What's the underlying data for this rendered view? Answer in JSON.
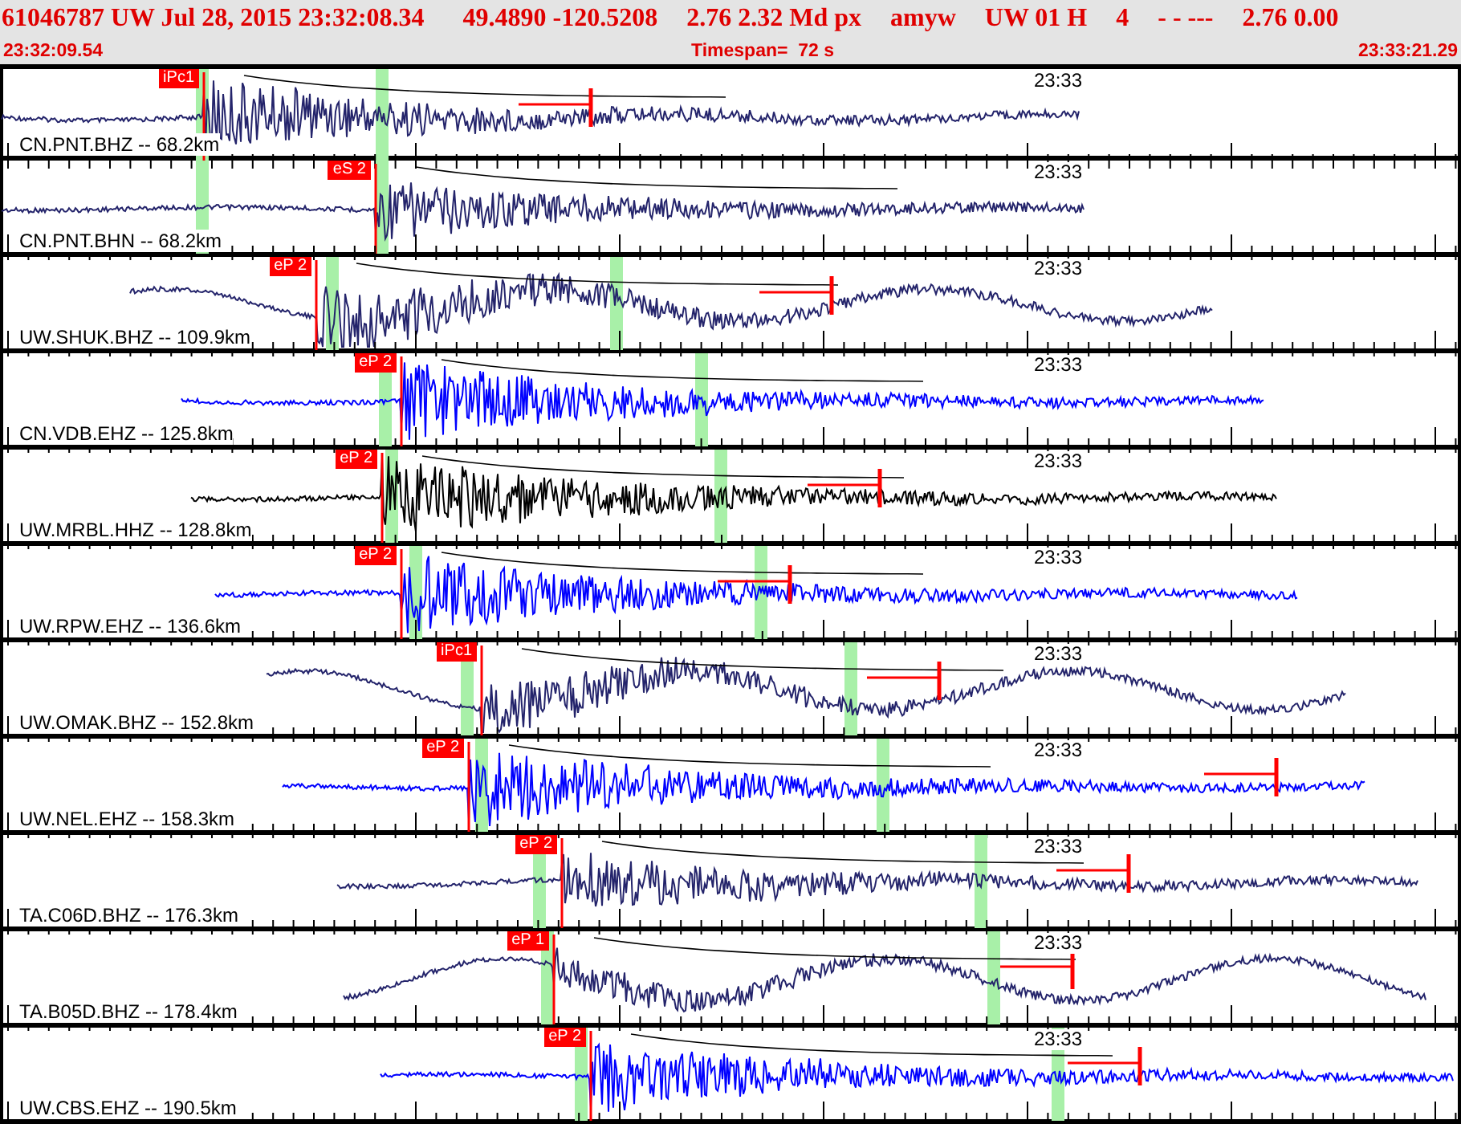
{
  "header": {
    "fields": [
      "61046787 UW Jul 28, 2015 23:32:08.34",
      "49.4890 -120.5208",
      "2.76 2.32 Md px",
      "amyw",
      "UW 01 H",
      "4",
      "- - ---",
      "2.76 0.00"
    ],
    "start_time": "23:32:09.54",
    "timespan": "Timespan=  72 s",
    "end_time": "23:33:21.29"
  },
  "traces": [
    {
      "channel": "CN.PNT.BHZ -- 68.2km",
      "pick": "iPc1",
      "time_mark": "23:33",
      "color": "#24246b"
    },
    {
      "channel": "CN.PNT.BHN -- 68.2km",
      "pick": "eS 2",
      "time_mark": "23:33",
      "color": "#24246b"
    },
    {
      "channel": "UW.SHUK.BHZ -- 109.9km",
      "pick": "eP 2",
      "time_mark": "23:33",
      "color": "#24246b"
    },
    {
      "channel": "CN.VDB.EHZ -- 125.8km",
      "pick": "eP 2",
      "time_mark": "23:33",
      "color": "#0000ff"
    },
    {
      "channel": "UW.MRBL.HHZ -- 128.8km",
      "pick": "eP 2",
      "time_mark": "23:33",
      "color": "#000000"
    },
    {
      "channel": "UW.RPW.EHZ -- 136.6km",
      "pick": "eP 2",
      "time_mark": "23:33",
      "color": "#0000ff"
    },
    {
      "channel": "UW.OMAK.BHZ -- 152.8km",
      "pick": "iPc1",
      "time_mark": "23:33",
      "color": "#24246b"
    },
    {
      "channel": "UW.NEL.EHZ -- 158.3km",
      "pick": "eP 2",
      "time_mark": "23:33",
      "color": "#0000ff"
    },
    {
      "channel": "TA.C06D.BHZ -- 176.3km",
      "pick": "eP 2",
      "time_mark": "23:33",
      "color": "#24246b"
    },
    {
      "channel": "TA.B05D.BHZ -- 178.4km",
      "pick": "eP 1",
      "time_mark": "23:33",
      "color": "#24246b"
    },
    {
      "channel": "UW.CBS.EHZ -- 190.5km",
      "pick": "eP 2",
      "time_mark": "23:33",
      "color": "#0000ff"
    }
  ]
}
